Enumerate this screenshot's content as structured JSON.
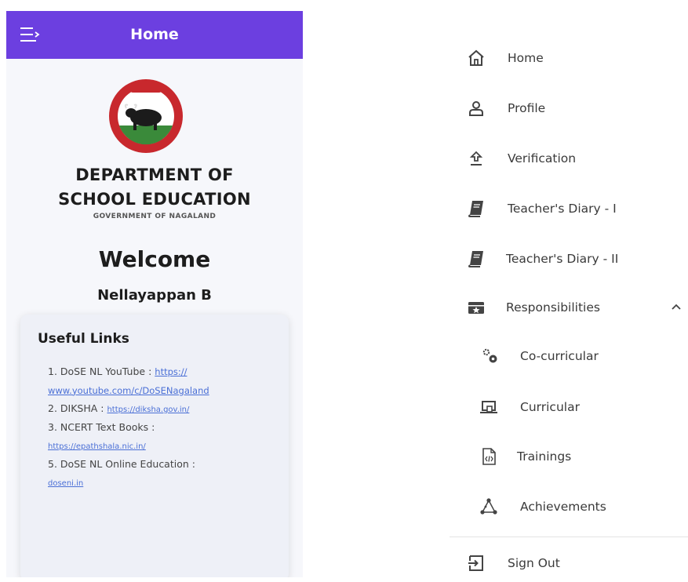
{
  "appbar": {
    "title": "Home",
    "menu_icon": "menu-icon"
  },
  "logo": {
    "ring_color": "#c8282d",
    "fill_color": "#3a8a3a",
    "seal_icon": "government-seal-logo"
  },
  "department": {
    "line1": "DEPARTMENT OF",
    "line2": "SCHOOL EDUCATION",
    "subtitle": "GOVERNMENT OF NAGALAND"
  },
  "welcome": {
    "heading": "Welcome",
    "user_name": "Nellayappan B"
  },
  "useful_links": {
    "title": "Useful Links",
    "items": [
      {
        "label": "1. DoSE NL YouTube :",
        "url_part1": "https://",
        "url_part2": "www.youtube.com/c/DoSENagaland"
      },
      {
        "label": "2. DIKSHA :",
        "url": "https://diksha.gov.in/"
      },
      {
        "label": "3. NCERT Text Books :",
        "url": "https://epathshala.nic.in/"
      },
      {
        "label": "5. DoSE NL Online Education :",
        "url": "doseni.in"
      }
    ]
  },
  "drawer": {
    "items": [
      {
        "label": "Home",
        "icon": "home-icon"
      },
      {
        "label": "Profile",
        "icon": "user-icon"
      },
      {
        "label": "Verification",
        "icon": "upload-icon"
      },
      {
        "label": "Teacher's Diary - I",
        "icon": "book-icon"
      },
      {
        "label": "Teacher's Diary - II",
        "icon": "book-icon"
      },
      {
        "label": "Responsibilities",
        "icon": "star-card-icon",
        "expanded": true
      },
      {
        "label": "Co-curricular",
        "icon": "gears-icon"
      },
      {
        "label": "Curricular",
        "icon": "laptop-icon"
      },
      {
        "label": "Trainings",
        "icon": "code-file-icon"
      },
      {
        "label": "Achievements",
        "icon": "network-icon"
      },
      {
        "label": "Sign Out",
        "icon": "sign-out-icon"
      }
    ]
  },
  "colors": {
    "accent": "#6c3fe0",
    "link": "#4a6fd6"
  }
}
